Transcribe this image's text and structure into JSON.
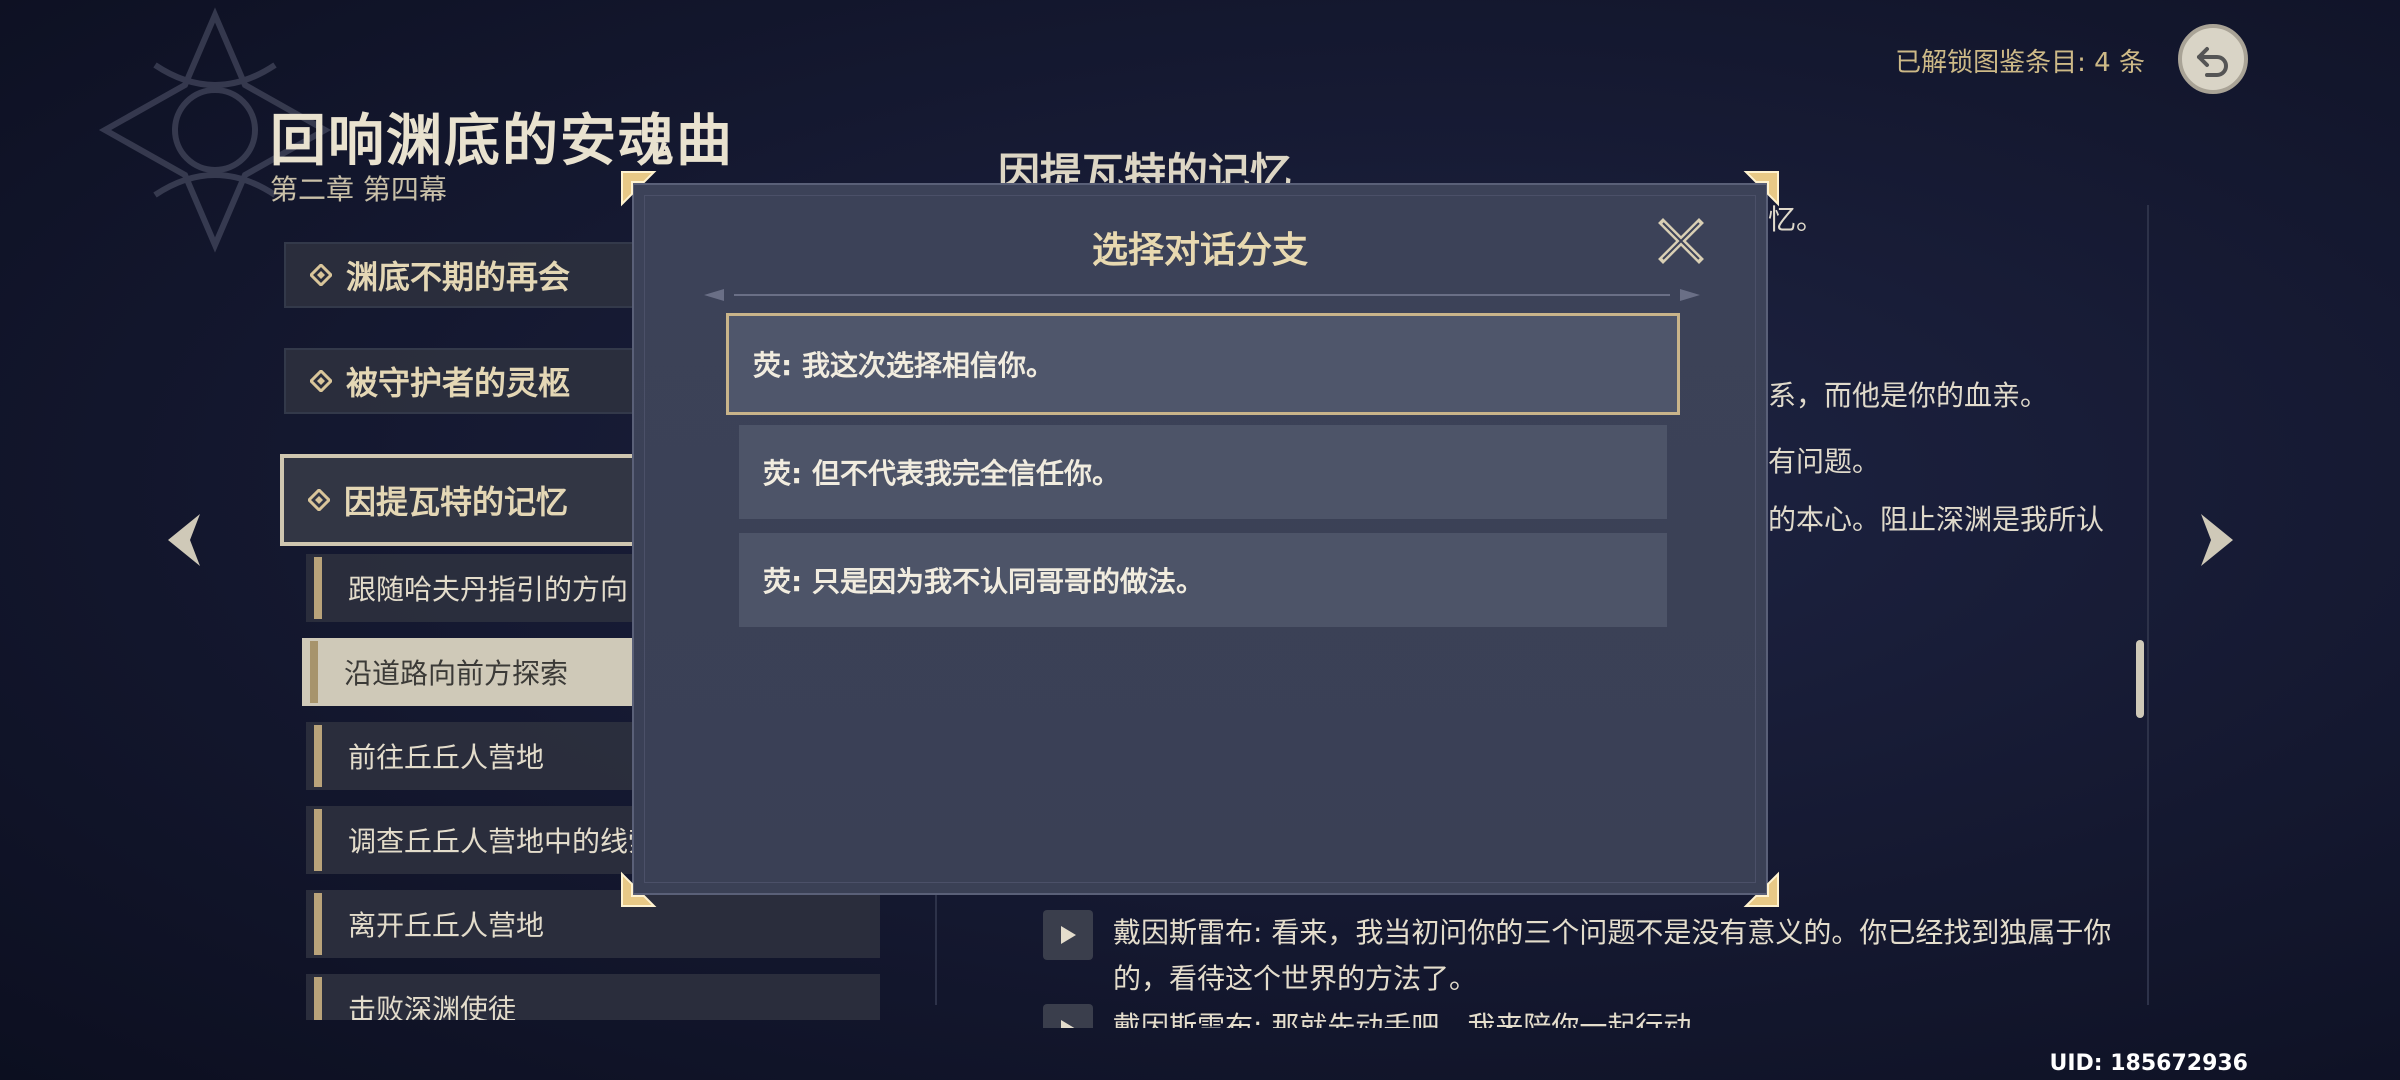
{
  "header": {
    "chapter_title": "回响渊底的安魂曲",
    "chapter_sub": "第二章 第四幕",
    "unlocked": "已解锁图鉴条目:  4 条",
    "uid": "UID: 185672936"
  },
  "quests": [
    {
      "label": "渊底不期的再会"
    },
    {
      "label": "被守护者的灵柩"
    },
    {
      "label": "因提瓦特的记忆"
    }
  ],
  "subquests": [
    {
      "label": "跟随哈夫丹指引的方向"
    },
    {
      "label": "沿道路向前方探索"
    },
    {
      "label": "前往丘丘人营地"
    },
    {
      "label": "调查丘丘人营地中的线索"
    },
    {
      "label": "离开丘丘人营地"
    },
    {
      "label": "击败深渊使徒"
    }
  ],
  "memory": {
    "title": "因提瓦特的记忆",
    "frag1": "忆。",
    "frag2": "系，而他是你的血亲。",
    "frag3": "有问题。",
    "frag4": "的本心。阻止深渊是我所认",
    "dialogue1": "戴因斯雷布: 看来，我当初问你的三个问题不是没有意义的。你已经找到独属于你的，看待这个世界的方法了。",
    "dialogue2": "戴因斯雷布: 那就先动手吧，我来陪你一起行动。"
  },
  "modal": {
    "title": "选择对话分支",
    "options": [
      {
        "label": "荧: 我这次选择相信你。"
      },
      {
        "label": "荧: 但不代表我完全信任你。"
      },
      {
        "label": "荧: 只是因为我不认同哥哥的做法。"
      }
    ]
  },
  "icons": {
    "back": "back-arrow-icon",
    "close": "close-icon",
    "nav_left": "chevron-left-icon",
    "nav_right": "chevron-right-icon",
    "play": "play-icon"
  },
  "colors": {
    "gold": "#cdb987",
    "modal_bg": "#3c4258",
    "option_bg": "#4d5468"
  }
}
